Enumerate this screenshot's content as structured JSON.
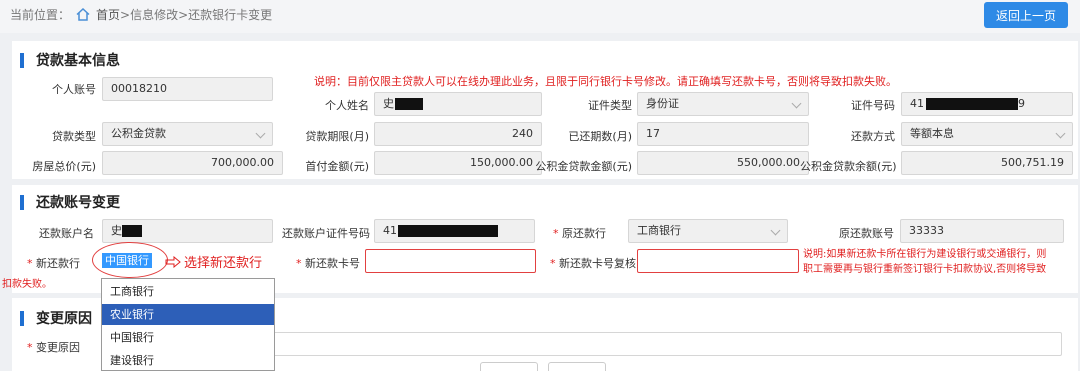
{
  "breadcrumb": {
    "prefix": "当前位置：",
    "home": "首页",
    "path": " >信息修改>还款银行卡变更"
  },
  "back_button": "返回上一页",
  "loan_info": {
    "title": "贷款基本信息",
    "notice": "说明：目前仅限主贷款人可以在线办理此业务，且限于同行银行卡号修改。请正确填写还款卡号，否则将导致扣款失败。",
    "fields": {
      "account_no": {
        "label": "个人账号",
        "value": "00018210"
      },
      "name": {
        "label": "个人姓名",
        "value": "史"
      },
      "id_type": {
        "label": "证件类型",
        "value": "身份证"
      },
      "id_no": {
        "label": "证件号码",
        "value_prefix": "41",
        "value_suffix": "9"
      },
      "loan_type": {
        "label": "贷款类型",
        "value": "公积金贷款"
      },
      "loan_term": {
        "label": "贷款期限(月)",
        "value": "240"
      },
      "repaid_periods": {
        "label": "已还期数(月)",
        "value": "17"
      },
      "repay_method": {
        "label": "还款方式",
        "value": "等额本息"
      },
      "house_price": {
        "label": "房屋总价(元)",
        "value": "700,000.00"
      },
      "down_payment": {
        "label": "首付金额(元)",
        "value": "150,000.00"
      },
      "fund_loan_amount": {
        "label": "公积金贷款金额(元)",
        "value": "550,000.00"
      },
      "fund_loan_balance": {
        "label": "公积金贷款余额(元)",
        "value": "500,751.19"
      }
    }
  },
  "account_change": {
    "title": "还款账号变更",
    "fields": {
      "acct_name": {
        "label": "还款账户名",
        "value": "史"
      },
      "acct_id_no": {
        "label": "还款账户证件号码",
        "value": "41"
      },
      "orig_bank": {
        "label": "原还款行",
        "value": "工商银行"
      },
      "orig_acct": {
        "label": "原还款账号",
        "value": "33333"
      },
      "new_bank": {
        "label": "新还款行",
        "value": "中国银行"
      },
      "new_card": {
        "label": "新还款卡号",
        "value": ""
      },
      "new_card_confirm": {
        "label": "新还款卡号复核",
        "value": ""
      }
    },
    "required_mark": "*",
    "annotation": "选择新还款行",
    "notice_line1": "说明:如果新还款卡所在银行为建设银行或交通银行，则",
    "notice_line2": "职工需要再与银行重新签订银行卡扣款协议,否则将导致",
    "notice_line3": "扣款失败。",
    "bank_options": [
      "工商银行",
      "农业银行",
      "中国银行",
      "建设银行"
    ],
    "highlighted_option": "农业银行"
  },
  "change_reason": {
    "title": "变更原因",
    "label": "变更原因"
  },
  "colors": {
    "primary": "#2e8ae6",
    "accent_bar": "#1f6fd1",
    "warning": "#e02020",
    "dropdown_highlight": "#2d5fb8"
  }
}
